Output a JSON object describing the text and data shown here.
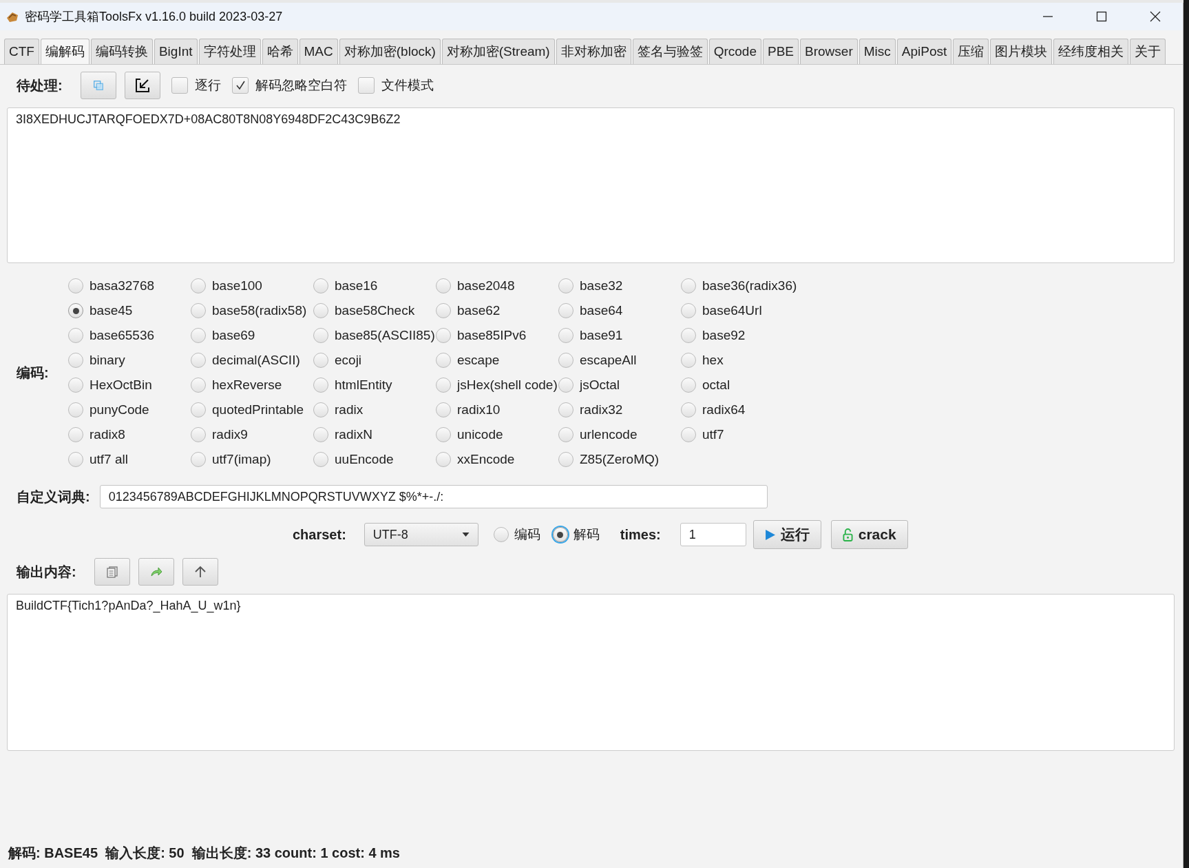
{
  "window": {
    "title": "密码学工具箱ToolsFx v1.16.0 build 2023-03-27"
  },
  "tabs": [
    {
      "label": "CTF",
      "selected": false
    },
    {
      "label": "编解码",
      "selected": true
    },
    {
      "label": "编码转换",
      "selected": false
    },
    {
      "label": "BigInt",
      "selected": false
    },
    {
      "label": "字符处理",
      "selected": false
    },
    {
      "label": "哈希",
      "selected": false
    },
    {
      "label": "MAC",
      "selected": false
    },
    {
      "label": "对称加密(block)",
      "selected": false
    },
    {
      "label": "对称加密(Stream)",
      "selected": false
    },
    {
      "label": "非对称加密",
      "selected": false
    },
    {
      "label": "签名与验签",
      "selected": false
    },
    {
      "label": "Qrcode",
      "selected": false
    },
    {
      "label": "PBE",
      "selected": false
    },
    {
      "label": "Browser",
      "selected": false
    },
    {
      "label": "Misc",
      "selected": false
    },
    {
      "label": "ApiPost",
      "selected": false
    },
    {
      "label": "压缩",
      "selected": false
    },
    {
      "label": "图片模块",
      "selected": false
    },
    {
      "label": "经纬度相关",
      "selected": false
    },
    {
      "label": "关于",
      "selected": false
    }
  ],
  "input": {
    "label": "待处理:",
    "checkboxes": [
      {
        "label": "逐行",
        "checked": false
      },
      {
        "label": "解码忽略空白符",
        "checked": true
      },
      {
        "label": "文件模式",
        "checked": false
      }
    ],
    "value": "3I8XEDHUCJTARQFOEDX7D+08AC80T8N08Y6948DF2C43C9B6Z2"
  },
  "encodings": {
    "label": "编码:",
    "options": [
      {
        "label": "basa32768",
        "selected": false
      },
      {
        "label": "base100",
        "selected": false
      },
      {
        "label": "base16",
        "selected": false
      },
      {
        "label": "base2048",
        "selected": false
      },
      {
        "label": "base32",
        "selected": false
      },
      {
        "label": "base36(radix36)",
        "selected": false
      },
      {
        "label": "base45",
        "selected": true
      },
      {
        "label": "base58(radix58)",
        "selected": false
      },
      {
        "label": "base58Check",
        "selected": false
      },
      {
        "label": "base62",
        "selected": false
      },
      {
        "label": "base64",
        "selected": false
      },
      {
        "label": "base64Url",
        "selected": false
      },
      {
        "label": "base65536",
        "selected": false
      },
      {
        "label": "base69",
        "selected": false
      },
      {
        "label": "base85(ASCII85)",
        "selected": false
      },
      {
        "label": "base85IPv6",
        "selected": false
      },
      {
        "label": "base91",
        "selected": false
      },
      {
        "label": "base92",
        "selected": false
      },
      {
        "label": "binary",
        "selected": false
      },
      {
        "label": "decimal(ASCII)",
        "selected": false
      },
      {
        "label": "ecoji",
        "selected": false
      },
      {
        "label": "escape",
        "selected": false
      },
      {
        "label": "escapeAll",
        "selected": false
      },
      {
        "label": "hex",
        "selected": false
      },
      {
        "label": "HexOctBin",
        "selected": false
      },
      {
        "label": "hexReverse",
        "selected": false
      },
      {
        "label": "htmlEntity",
        "selected": false
      },
      {
        "label": "jsHex(shell code)",
        "selected": false
      },
      {
        "label": "jsOctal",
        "selected": false
      },
      {
        "label": "octal",
        "selected": false
      },
      {
        "label": "punyCode",
        "selected": false
      },
      {
        "label": "quotedPrintable",
        "selected": false
      },
      {
        "label": "radix",
        "selected": false
      },
      {
        "label": "radix10",
        "selected": false
      },
      {
        "label": "radix32",
        "selected": false
      },
      {
        "label": "radix64",
        "selected": false
      },
      {
        "label": "radix8",
        "selected": false
      },
      {
        "label": "radix9",
        "selected": false
      },
      {
        "label": "radixN",
        "selected": false
      },
      {
        "label": "unicode",
        "selected": false
      },
      {
        "label": "urlencode",
        "selected": false
      },
      {
        "label": "utf7",
        "selected": false
      },
      {
        "label": "utf7 all",
        "selected": false
      },
      {
        "label": "utf7(imap)",
        "selected": false
      },
      {
        "label": "uuEncode",
        "selected": false
      },
      {
        "label": "xxEncode",
        "selected": false
      },
      {
        "label": "Z85(ZeroMQ)",
        "selected": false
      }
    ]
  },
  "dictionary": {
    "label": "自定义词典:",
    "value": "0123456789ABCDEFGHIJKLMNOPQRSTUVWXYZ $%*+-./:"
  },
  "run_bar": {
    "charset_label": "charset:",
    "charset": "UTF-8",
    "modes": [
      {
        "label": "编码",
        "selected": false
      },
      {
        "label": "解码",
        "selected": true
      }
    ],
    "times_label": "times:",
    "times": "1",
    "run_button": "运行",
    "crack_button": "crack"
  },
  "output": {
    "label": "输出内容:",
    "value": "BuildCTF{Tich1?pAnDa?_HahA_U_w1n}"
  },
  "status_bar": "解码: BASE45  输入长度: 50  输出长度: 33 count: 1 cost: 4 ms"
}
